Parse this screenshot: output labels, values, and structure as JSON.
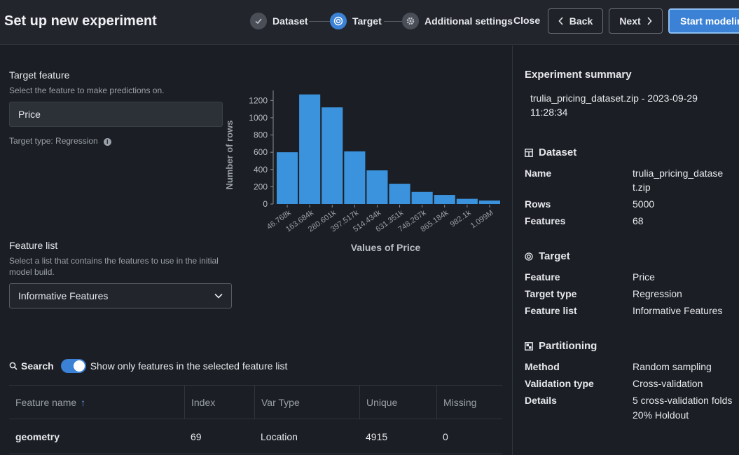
{
  "header": {
    "title": "Set up new experiment",
    "steps": [
      {
        "label": "Dataset",
        "icon": "check-icon"
      },
      {
        "label": "Target",
        "icon": "target-icon"
      },
      {
        "label": "Additional settings",
        "icon": "gear-icon"
      }
    ],
    "close_label": "Close",
    "back_label": "Back",
    "next_label": "Next",
    "start_label": "Start modeling"
  },
  "target": {
    "heading": "Target feature",
    "hint": "Select the feature to make predictions on.",
    "value": "Price",
    "type_text": "Target type: Regression"
  },
  "feature_list": {
    "heading": "Feature list",
    "hint": "Select a list that contains the features to use in the initial model build.",
    "selected": "Informative Features"
  },
  "chart_data": {
    "type": "bar",
    "categories": [
      "46.768k",
      "163.684k",
      "280.601k",
      "397.517k",
      "514.434k",
      "631.351k",
      "748.267k",
      "865.184k",
      "982.1k",
      "1.099M"
    ],
    "values": [
      600,
      1270,
      1120,
      610,
      390,
      235,
      140,
      105,
      60,
      40
    ],
    "ylim": [
      0,
      1300
    ],
    "yticks": [
      0,
      200,
      400,
      600,
      800,
      1000,
      1200
    ],
    "xlabel": "Values of Price",
    "ylabel": "Number of rows",
    "bar_color": "#3b93dd"
  },
  "search": {
    "label": "Search",
    "toggle_label": "Show only features in the selected feature list",
    "toggle_on": true
  },
  "table": {
    "columns": [
      "Feature name",
      "Index",
      "Var Type",
      "Unique",
      "Missing"
    ],
    "rows": [
      [
        "geometry",
        "69",
        "Location",
        "4915",
        "0"
      ]
    ]
  },
  "summary": {
    "title": "Experiment summary",
    "file": "trulia_pricing_dataset.zip - 2023-09-29 11:28:34",
    "dataset": {
      "heading": "Dataset",
      "name_k": "Name",
      "name_v": "trulia_pricing_dataset.zip",
      "rows_k": "Rows",
      "rows_v": "5000",
      "features_k": "Features",
      "features_v": "68"
    },
    "target": {
      "heading": "Target",
      "feature_k": "Feature",
      "feature_v": "Price",
      "type_k": "Target type",
      "type_v": "Regression",
      "list_k": "Feature list",
      "list_v": "Informative Features"
    },
    "partitioning": {
      "heading": "Partitioning",
      "method_k": "Method",
      "method_v": "Random sampling",
      "validation_k": "Validation type",
      "validation_v": "Cross-validation",
      "details_k": "Details",
      "details_v1": "5 cross-validation folds",
      "details_v2": "20% Holdout"
    }
  },
  "colors": {
    "accent": "#3b82d6",
    "background": "#1b1e24",
    "header": "#22252c"
  }
}
